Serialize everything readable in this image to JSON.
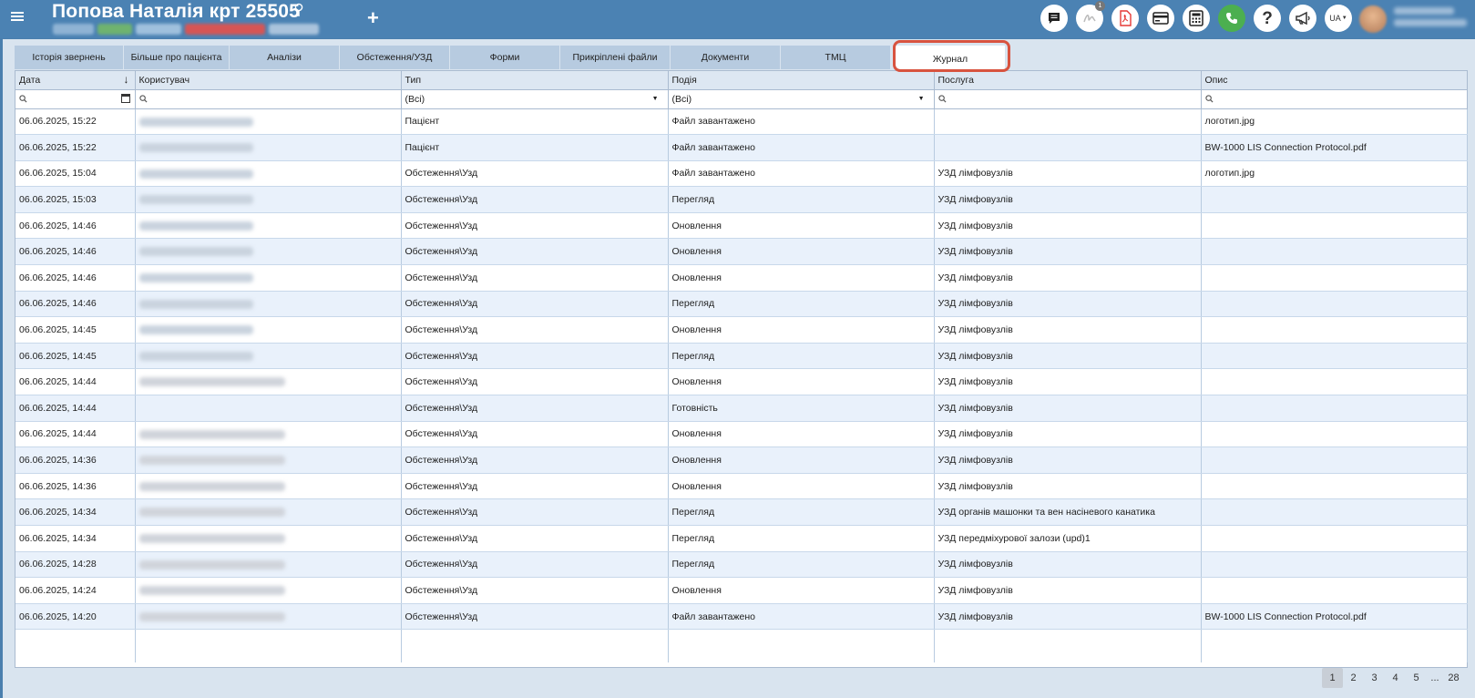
{
  "header": {
    "title": "Попова Наталія крт 25505",
    "add_label": "+",
    "lang": "UA",
    "notification_count": "1"
  },
  "tabs": [
    {
      "label": "Історія звернень"
    },
    {
      "label": "Більше про пацієнта"
    },
    {
      "label": "Аналізи"
    },
    {
      "label": "Обстеження/УЗД"
    },
    {
      "label": "Форми"
    },
    {
      "label": "Прикріплені файли"
    },
    {
      "label": "Документи"
    },
    {
      "label": "ТМЦ"
    },
    {
      "label": "Журнал"
    }
  ],
  "active_tab": "Журнал",
  "table": {
    "columns": [
      "Дата",
      "Користувач",
      "Тип",
      "Подія",
      "Послуга",
      "Опис"
    ],
    "filters": {
      "type": "(Всі)",
      "event": "(Всі)"
    },
    "rows": [
      {
        "date": "06.06.2025, 15:22",
        "user": "blurred",
        "type": "Пацієнт",
        "event": "Файл завантажено",
        "service": "",
        "desc": "логотип.jpg"
      },
      {
        "date": "06.06.2025, 15:22",
        "user": "blurred",
        "type": "Пацієнт",
        "event": "Файл завантажено",
        "service": "",
        "desc": "BW-1000 LIS Connection Protocol.pdf"
      },
      {
        "date": "06.06.2025, 15:04",
        "user": "blurred",
        "type": "Обстеження\\Узд",
        "event": "Файл завантажено",
        "service": "УЗД лімфовузлів",
        "desc": "логотип.jpg"
      },
      {
        "date": "06.06.2025, 15:03",
        "user": "blurred",
        "type": "Обстеження\\Узд",
        "event": "Перегляд",
        "service": "УЗД лімфовузлів",
        "desc": ""
      },
      {
        "date": "06.06.2025, 14:46",
        "user": "blurred",
        "type": "Обстеження\\Узд",
        "event": "Оновлення",
        "service": "УЗД лімфовузлів",
        "desc": ""
      },
      {
        "date": "06.06.2025, 14:46",
        "user": "blurred",
        "type": "Обстеження\\Узд",
        "event": "Оновлення",
        "service": "УЗД лімфовузлів",
        "desc": ""
      },
      {
        "date": "06.06.2025, 14:46",
        "user": "blurred",
        "type": "Обстеження\\Узд",
        "event": "Оновлення",
        "service": "УЗД лімфовузлів",
        "desc": ""
      },
      {
        "date": "06.06.2025, 14:46",
        "user": "blurred",
        "type": "Обстеження\\Узд",
        "event": "Перегляд",
        "service": "УЗД лімфовузлів",
        "desc": ""
      },
      {
        "date": "06.06.2025, 14:45",
        "user": "blurred",
        "type": "Обстеження\\Узд",
        "event": "Оновлення",
        "service": "УЗД лімфовузлів",
        "desc": ""
      },
      {
        "date": "06.06.2025, 14:45",
        "user": "blurred",
        "type": "Обстеження\\Узд",
        "event": "Перегляд",
        "service": "УЗД лімфовузлів",
        "desc": ""
      },
      {
        "date": "06.06.2025, 14:44",
        "user": "blurred-mail",
        "type": "Обстеження\\Узд",
        "event": "Оновлення",
        "service": "УЗД лімфовузлів",
        "desc": ""
      },
      {
        "date": "06.06.2025, 14:44",
        "user": "",
        "type": "Обстеження\\Узд",
        "event": "Готовність",
        "service": "УЗД лімфовузлів",
        "desc": ""
      },
      {
        "date": "06.06.2025, 14:44",
        "user": "blurred-mail",
        "type": "Обстеження\\Узд",
        "event": "Оновлення",
        "service": "УЗД лімфовузлів",
        "desc": ""
      },
      {
        "date": "06.06.2025, 14:36",
        "user": "blurred-mail",
        "type": "Обстеження\\Узд",
        "event": "Оновлення",
        "service": "УЗД лімфовузлів",
        "desc": ""
      },
      {
        "date": "06.06.2025, 14:36",
        "user": "blurred-mail",
        "type": "Обстеження\\Узд",
        "event": "Оновлення",
        "service": "УЗД лімфовузлів",
        "desc": ""
      },
      {
        "date": "06.06.2025, 14:34",
        "user": "blurred-mail",
        "type": "Обстеження\\Узд",
        "event": "Перегляд",
        "service": "УЗД органів машонки та вен насіневого канатика",
        "desc": ""
      },
      {
        "date": "06.06.2025, 14:34",
        "user": "blurred-mail",
        "type": "Обстеження\\Узд",
        "event": "Перегляд",
        "service": "УЗД передміхурової залози (upd)1",
        "desc": ""
      },
      {
        "date": "06.06.2025, 14:28",
        "user": "blurred-mail",
        "type": "Обстеження\\Узд",
        "event": "Перегляд",
        "service": "УЗД лімфовузлів",
        "desc": ""
      },
      {
        "date": "06.06.2025, 14:24",
        "user": "blurred-mail",
        "type": "Обстеження\\Узд",
        "event": "Оновлення",
        "service": "УЗД лімфовузлів",
        "desc": ""
      },
      {
        "date": "06.06.2025, 14:20",
        "user": "blurred-mail",
        "type": "Обстеження\\Узд",
        "event": "Файл завантажено",
        "service": "УЗД лімфовузлів",
        "desc": "BW-1000 LIS Connection Protocol.pdf"
      }
    ]
  },
  "pagination": {
    "pages": [
      "1",
      "2",
      "3",
      "4",
      "5"
    ],
    "ellipsis": "...",
    "last": "28",
    "current": "1"
  },
  "colors": {
    "header_bg": "#4b82b3",
    "panel_bg": "#d9e4ef",
    "tab_bg": "#b7cbe0",
    "row_alt": "#e9f1fb",
    "highlight": "#d8533f",
    "phone_green": "#4caf50",
    "pdf_red": "#e53935"
  },
  "icons": [
    "menu-icon",
    "pin-icon",
    "chat-icon",
    "signature-icon",
    "pdf-icon",
    "card-icon",
    "calculator-icon",
    "phone-icon",
    "help-icon",
    "megaphone-icon",
    "language-dropdown",
    "avatar"
  ]
}
